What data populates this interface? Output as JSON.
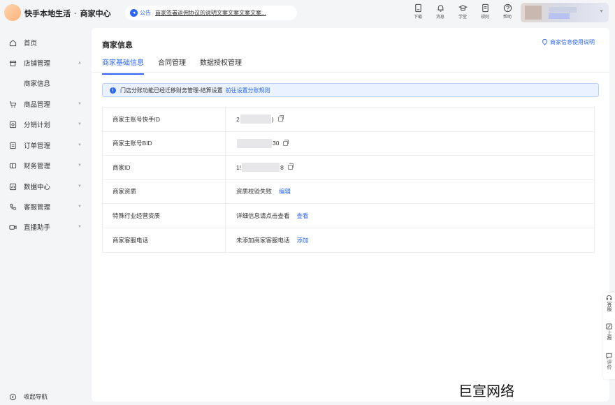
{
  "header": {
    "brand": "快手本地生活",
    "section": "商家中心",
    "notice_tag": "公告",
    "notice_text": "商家签署返佣协议的说明文案文案文案文案...",
    "tools": [
      {
        "label": "下载",
        "icon": "download-icon"
      },
      {
        "label": "消息",
        "icon": "bell-icon"
      },
      {
        "label": "学堂",
        "icon": "graduation-cap-icon"
      },
      {
        "label": "规则",
        "icon": "document-icon"
      },
      {
        "label": "帮助",
        "icon": "help-icon"
      }
    ]
  },
  "sidebar": {
    "items": [
      {
        "label": "首页",
        "icon": "home-icon"
      },
      {
        "label": "店铺管理",
        "icon": "store-icon"
      },
      {
        "label": "商家信息",
        "icon": ""
      },
      {
        "label": "商品管理",
        "icon": "cart-icon"
      },
      {
        "label": "分销计划",
        "icon": "distribution-icon"
      },
      {
        "label": "订单管理",
        "icon": "order-icon"
      },
      {
        "label": "财务管理",
        "icon": "wallet-icon"
      },
      {
        "label": "数据中心",
        "icon": "chart-icon"
      },
      {
        "label": "客服管理",
        "icon": "phone-icon"
      },
      {
        "label": "直播助手",
        "icon": "video-icon"
      }
    ],
    "collapse_label": "收起导航"
  },
  "main": {
    "title": "商家信息",
    "help_link": "商家信息使用说明",
    "tabs": [
      "商家基础信息",
      "合同管理",
      "数据授权管理"
    ],
    "active_tab": 0,
    "alert": {
      "text": "门店分账功能已经迁移财务管理-结算设置",
      "link": "前往设置分账规则"
    },
    "rows": [
      {
        "key": "商家主账号快手ID",
        "prefix": "2",
        "suffix": ")"
      },
      {
        "key": "商家主账号BID",
        "prefix": "",
        "suffix": "30"
      },
      {
        "key": "商家ID",
        "prefix": "1!",
        "suffix": "8"
      },
      {
        "key": "商家资质",
        "value": "资质校验失败",
        "link": "编辑"
      },
      {
        "key": "特殊行业经营资质",
        "value": "详细信息请点击查看",
        "link": "查看"
      },
      {
        "key": "商家客服电话",
        "value": "未添加商家客服电话",
        "link": "添加"
      }
    ]
  },
  "floatbar": [
    {
      "label": "客服",
      "icon": "headset-icon"
    },
    {
      "label": "上报",
      "icon": "edit-icon"
    },
    {
      "label": "评价",
      "icon": "comment-icon"
    }
  ],
  "watermark": "巨宣网络",
  "colors": {
    "accent": "#2b66f6",
    "background": "#f4f5f7"
  }
}
